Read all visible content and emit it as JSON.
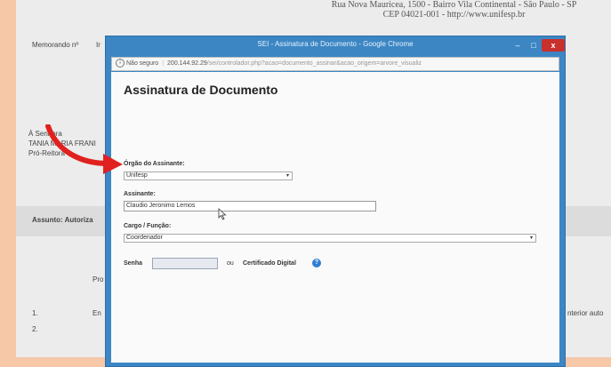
{
  "document": {
    "address_line1": "Rua Nova Mauricea, 1500 - Bairro Vila Continental - São Paulo - SP",
    "address_line2": "CEP 04021-001 - http://www.unifesp.br",
    "memo_label": "Memorando nº",
    "memo_suffix": "Ir",
    "to_line1": "À Senhora",
    "to_line2": "TANIA MARIA FRANI",
    "to_line3": "Pró-Reitora",
    "subject": "Assunto: Autoriza",
    "para": "Pro",
    "item1_number": "1.",
    "item1_text": "En",
    "item1_right": "nterior auto",
    "item2_number": "2."
  },
  "window": {
    "title": "SEI - Assinatura de Documento - Google Chrome",
    "minimize": "–",
    "maximize": "□",
    "close": "x",
    "security_label": "Não seguro",
    "url_host": "200.144.92.29",
    "url_path": "/sei/controlador.php?acao=documento_assinar&acao_origem=arvore_visualiz"
  },
  "form": {
    "heading": "Assinatura de Documento",
    "orgao_label": "Órgão do Assinante:",
    "orgao_value": "Unifesp",
    "assinante_label": "Assinante:",
    "assinante_value": "Claudio Jeronimo Lemos",
    "cargo_label": "Cargo / Função:",
    "cargo_value": "Coordenador",
    "senha_label": "Senha",
    "ou_label": "ou",
    "certificado_label": "Certificado Digital",
    "help_glyph": "?",
    "caret": "▾"
  },
  "colors": {
    "chrome_blue": "#3c86c4",
    "arrow_red": "#e0211f",
    "close_red": "#c9302c"
  }
}
